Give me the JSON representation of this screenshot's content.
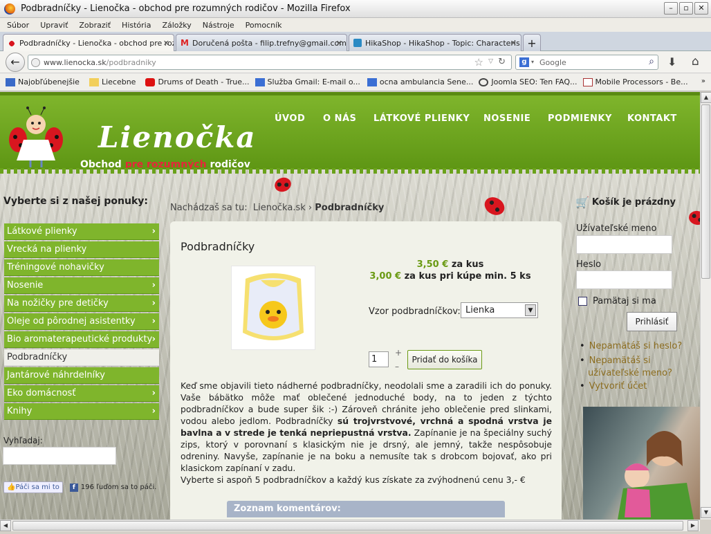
{
  "window": {
    "title": "Podbradníčky - Lienočka - obchod pre rozumných rodičov - Mozilla Firefox"
  },
  "menu": [
    "Súbor",
    "Upraviť",
    "Zobraziť",
    "História",
    "Záložky",
    "Nástroje",
    "Pomocník"
  ],
  "tabs": [
    {
      "label": "Podbradníčky - Lienočka - obchod pre roz...",
      "active": true
    },
    {
      "label": "Doručená pošta - filip.trefny@gmail.com ...",
      "active": false
    },
    {
      "label": "HikaShop - HikaShop - Topic: Characteris...",
      "active": false
    }
  ],
  "tab_new": "+",
  "url": {
    "domain": "www.lienocka.sk",
    "path": "/podbradniky"
  },
  "search": {
    "placeholder": "Google"
  },
  "bookmarks": [
    "Najobľúbenejšie",
    "Liecebne",
    "Drums of Death - True...",
    "Služba Gmail: E-mail o...",
    "ocna ambulancia Sene...",
    "Joomla SEO: Ten FAQ...",
    "Mobile Processors - Be..."
  ],
  "site": {
    "logo_title": "Lienočka",
    "logo_sub_a": "Obchod ",
    "logo_sub_b": "pre rozumných",
    "logo_sub_c": " rodičov",
    "nav": [
      "ÚVOD",
      "O NÁS",
      "LÁTKOVÉ PLIENKY",
      "NOSENIE",
      "PODMIENKY",
      "KONTAKT"
    ]
  },
  "sidebar": {
    "title": "Vyberte si z našej ponuky:",
    "categories": [
      {
        "label": "Látkové plienky",
        "arrow": true
      },
      {
        "label": "Vrecká na plienky",
        "arrow": false
      },
      {
        "label": "Tréningové nohavičky",
        "arrow": false
      },
      {
        "label": "Nosenie",
        "arrow": true
      },
      {
        "label": "Na nožičky pre detičky",
        "arrow": true
      },
      {
        "label": "Oleje od pôrodnej asistentky",
        "arrow": true
      },
      {
        "label": "Bio aromaterapeutické produkty",
        "arrow": true
      },
      {
        "label": "Podbradníčky",
        "arrow": false,
        "selected": true
      },
      {
        "label": "Jantárové náhrdelníky",
        "arrow": false
      },
      {
        "label": "Eko domácnosť",
        "arrow": true
      },
      {
        "label": "Knihy",
        "arrow": true
      }
    ],
    "search_label": "Vyhľadaj:",
    "like_label": "Páči sa mi to",
    "like_count": "196 ľuďom sa to páči."
  },
  "breadcrumb": {
    "prefix": "Nachádzaš sa tu:",
    "home": "Lienočka.sk",
    "sep": "›",
    "current": "Podbradníčky"
  },
  "product": {
    "title": "Podbradníčky",
    "price1": "3,50 €",
    "price1_suffix": "za kus",
    "price2": "3,00 €",
    "price2_suffix": "za kus pri kúpe min. 5 ks",
    "variant_label": "Vzor podbradníčkov:",
    "variant_value": "Lienka",
    "qty": "1",
    "plus": "+",
    "minus": "–",
    "add_button": "Pridať do košíka",
    "desc_1": "Keď sme objavili tieto nádherné podbradníčky, neodolali sme a zaradili ich do ponuky. Vaše bábätko môže mať oblečené jednoduché body, na to jeden z týchto podbradníčkov a bude super šik :-) Zároveň chránite jeho oblečenie pred slinkami, vodou alebo jedlom. Podbradníčky ",
    "desc_bold": "sú trojvrstvové, vrchná a spodná vrstva je bavlna a v strede je tenká nepriepustná vrstva.",
    "desc_2": " Zapínanie je na špeciálny suchý zips, ktorý v porovnaní s klasickým nie je drsný, ale jemný, takže nespôsobuje odreniny. Navyše, zapínanie je na boku a nemusíte tak s drobcom bojovať, ako pri klasickom zapínaní v zadu.",
    "desc_3": "Vyberte si aspoň 5 podbradníčkov a každý kus získate za zvýhodnenú cenu 3,- €",
    "comments_header": "Zoznam komentárov:"
  },
  "right": {
    "cart": "Košík je prázdny",
    "username_label": "Užívateľské meno",
    "password_label": "Heslo",
    "remember": "Pamätaj si ma",
    "login": "Prihlásiť",
    "links": [
      "Nepamätáš si heslo?",
      "Nepamätáš si užívateľské meno?",
      "Vytvoriť účet"
    ]
  },
  "colors": {
    "brand_green": "#7fb52c",
    "price_green": "#6a9a13",
    "link": "#8c6d1f"
  }
}
